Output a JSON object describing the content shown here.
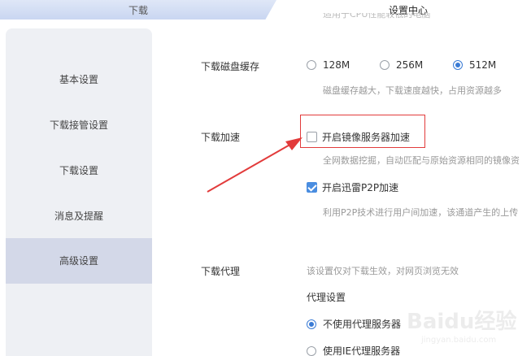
{
  "tabs": {
    "download": "下载",
    "settings": "设置中心"
  },
  "sidebar": {
    "items": [
      {
        "label": "基本设置"
      },
      {
        "label": "下载接管设置"
      },
      {
        "label": "下载设置"
      },
      {
        "label": "消息及提醒"
      },
      {
        "label": "高级设置"
      }
    ],
    "active_index": 4
  },
  "content": {
    "cut_top_text": "适用于CPU性能较低的电脑",
    "disk_cache": {
      "label": "下载磁盘缓存",
      "options": [
        "128M",
        "256M",
        "512M"
      ],
      "selected": "512M",
      "hint": "磁盘缓存越大，下载速度越快，占用资源越多"
    },
    "accel": {
      "label": "下载加速",
      "mirror": {
        "label": "开启镜像服务器加速",
        "checked": false,
        "hint": "全网数据挖掘，自动匹配与原始资源相同的镜像资"
      },
      "p2p": {
        "label": "开启迅雷P2P加速",
        "checked": true,
        "hint": "利用P2P技术进行用户间加速，该通道产生的上传"
      }
    },
    "proxy": {
      "label": "下载代理",
      "hint": "该设置仅对下载生效，对网页浏览无效",
      "subtitle": "代理设置",
      "options": [
        "不使用代理服务器",
        "使用IE代理服务器"
      ],
      "selected": "不使用代理服务器"
    }
  },
  "watermark": {
    "main": "Baidu经验",
    "sub": "jingyan.baidu.com"
  },
  "colors": {
    "accent": "#3a7bd5",
    "annotation": "#e23b3b",
    "sidebar_active": "#d3d8e8"
  }
}
